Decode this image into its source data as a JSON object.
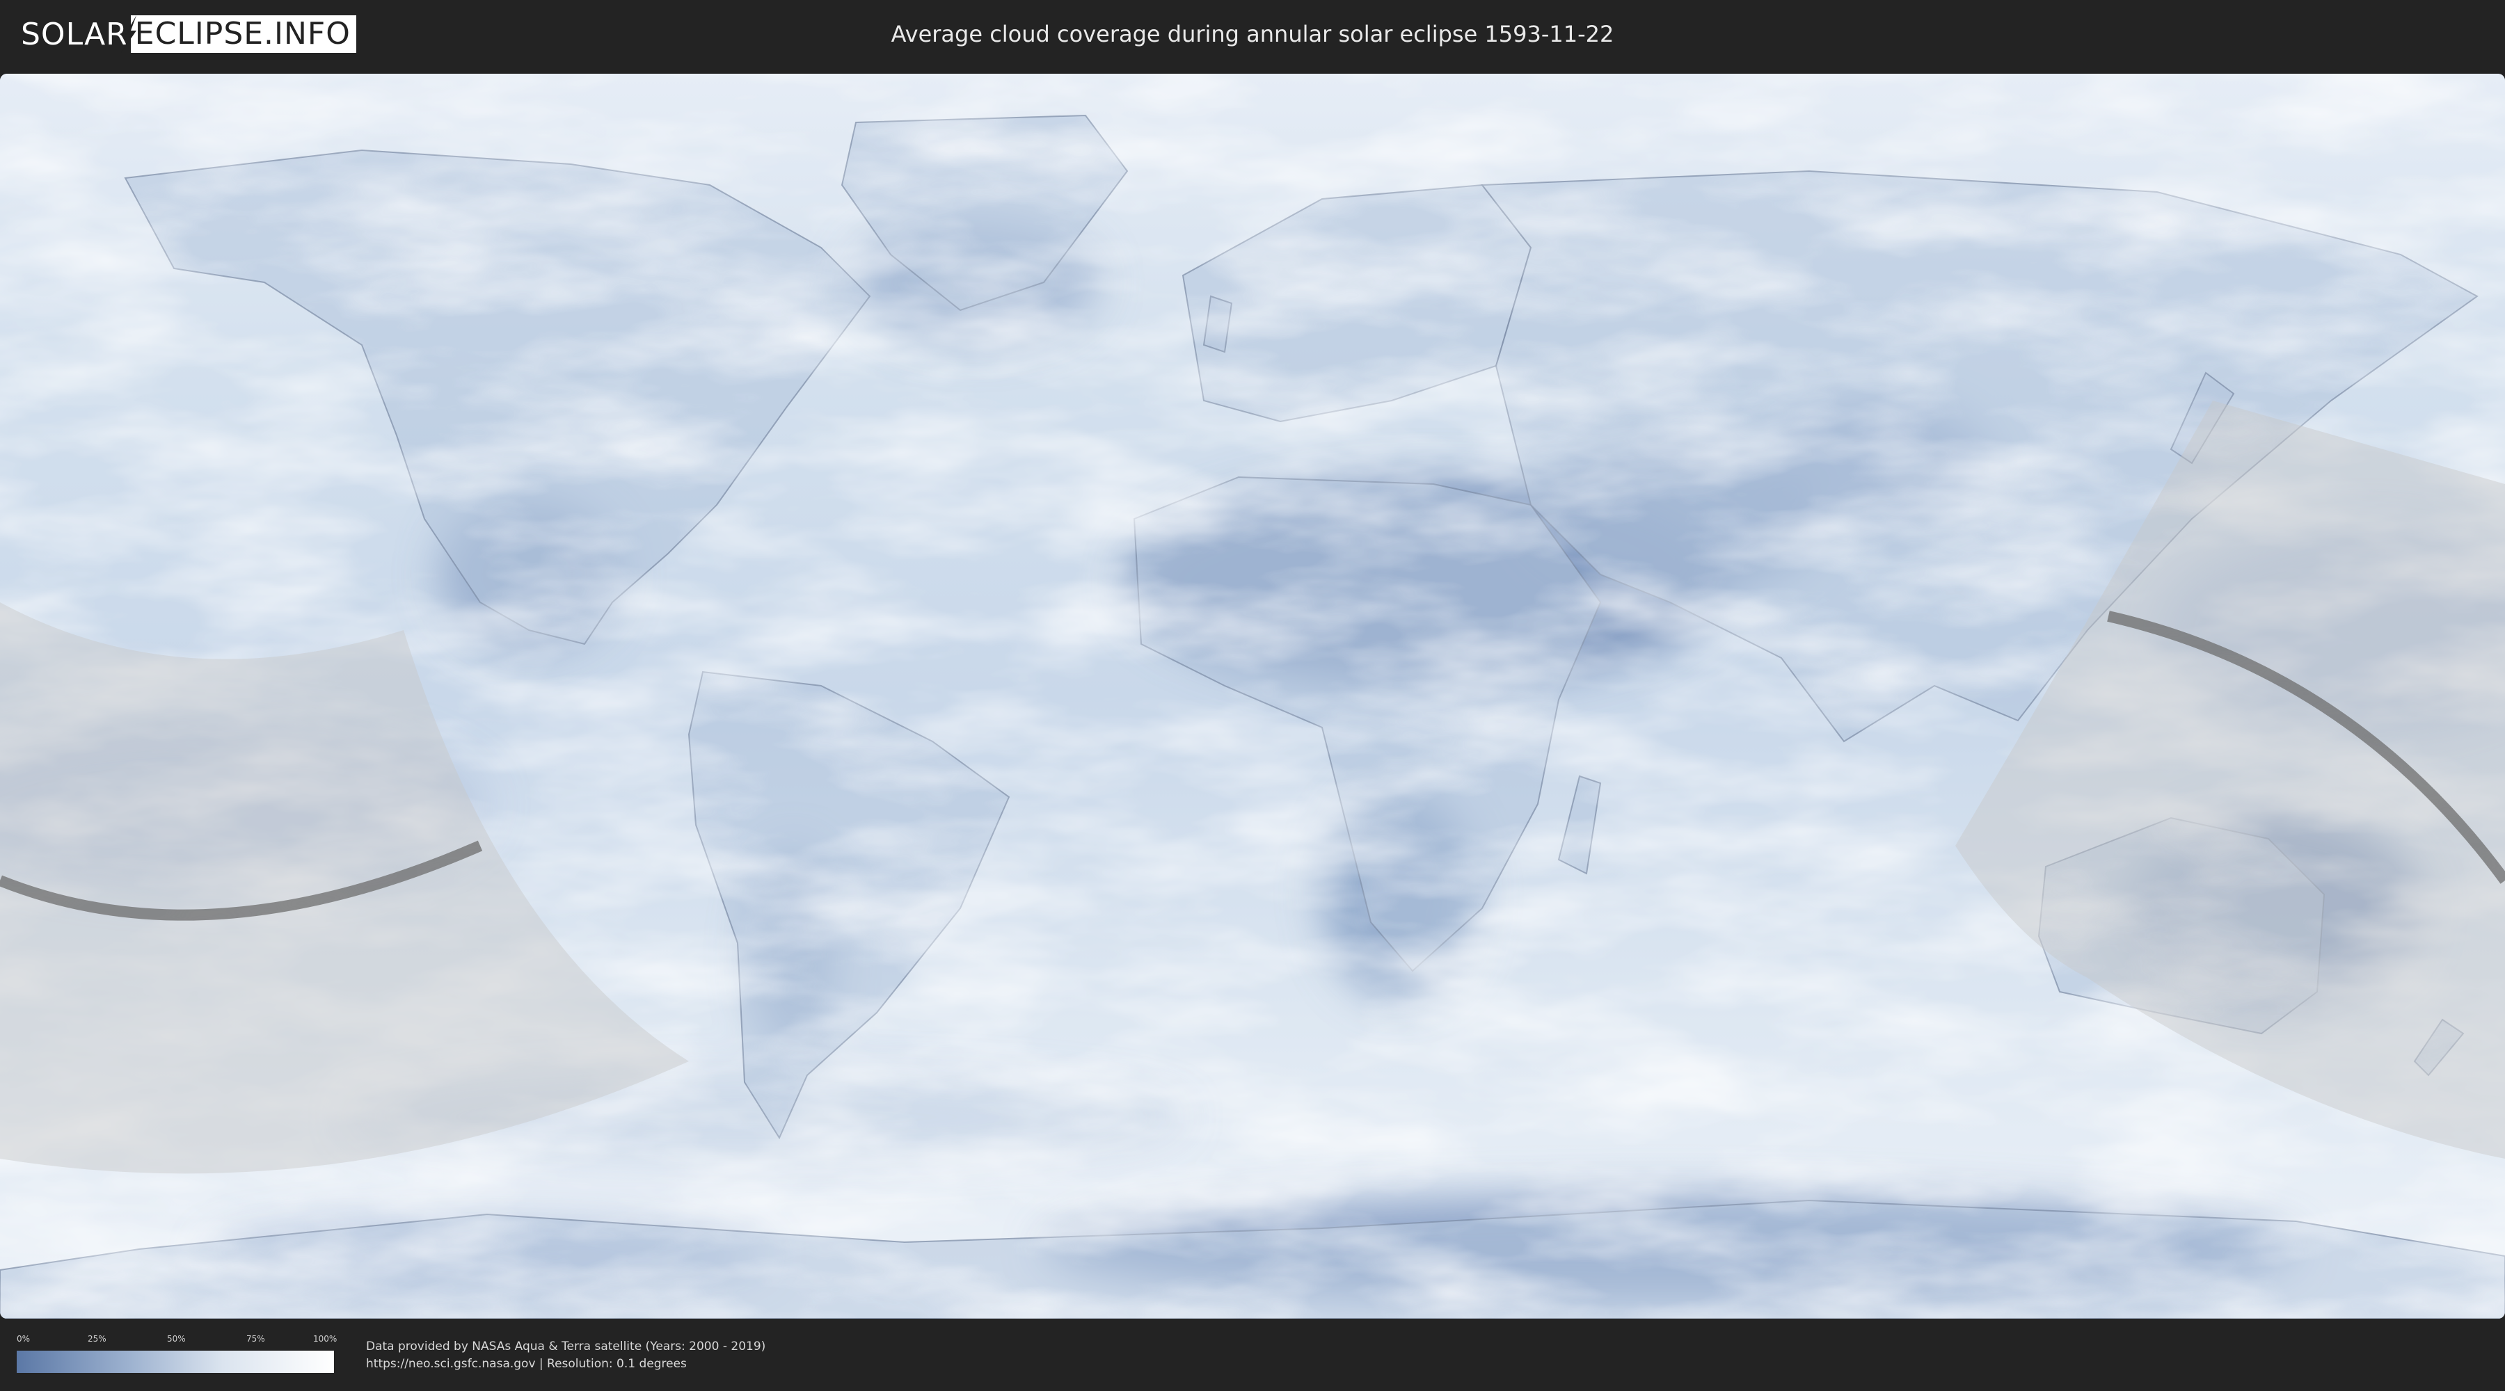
{
  "header": {
    "logo_left": "SOLAR",
    "logo_right": "ECLIPSE.INFO",
    "title": "Average cloud coverage during annular solar eclipse 1593-11-22"
  },
  "map": {
    "icon": "world-map-icon",
    "colors": {
      "background": "#232323",
      "clear_sky": "#5b78a6",
      "full_cloud": "#ffffff",
      "eclipse_zone": "#c8c8c8",
      "central_path": "#6e6e6e"
    }
  },
  "legend": {
    "ticks": [
      "0%",
      "25%",
      "50%",
      "75%",
      "100%"
    ],
    "gradient_start": "#5b78a6",
    "gradient_end": "#ffffff"
  },
  "credits": {
    "line1": "Data provided by NASAs Aqua & Terra satellite (Years: 2000 - 2019)",
    "line2": "https://neo.sci.gsfc.nasa.gov | Resolution: 0.1 degrees"
  }
}
